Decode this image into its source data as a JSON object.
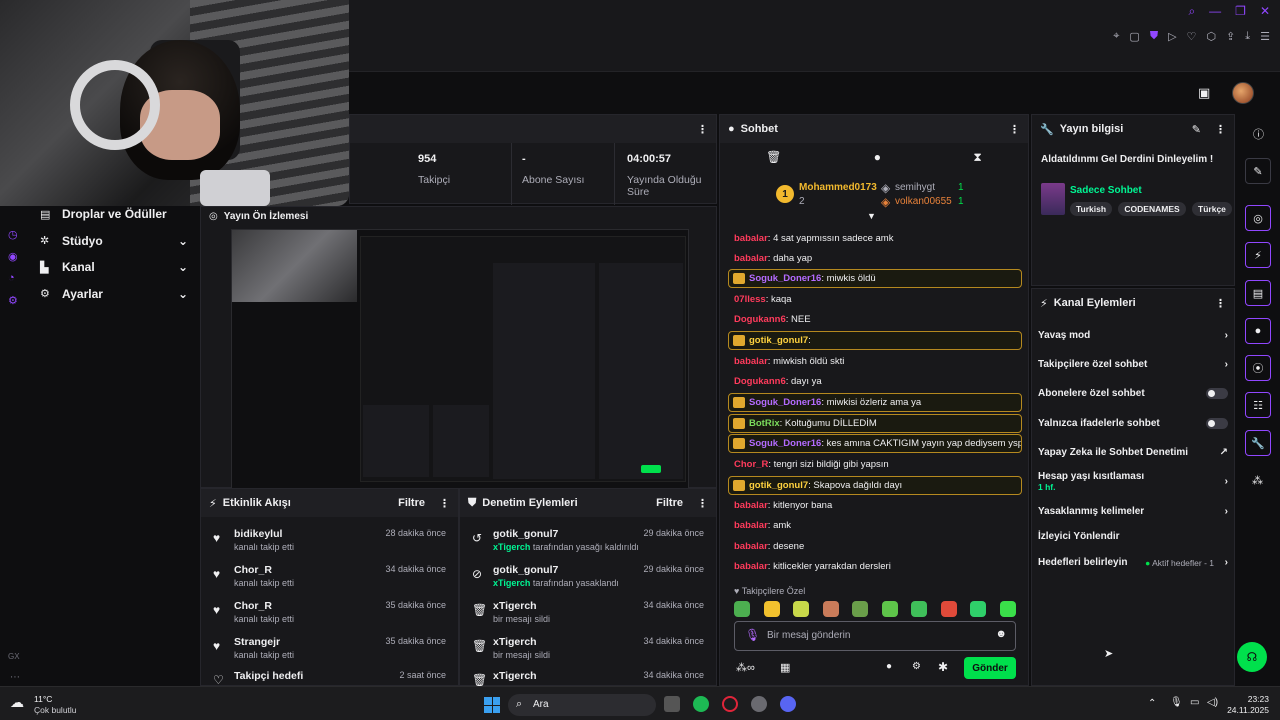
{
  "stats": [
    {
      "value": "954",
      "label": "Takipçi"
    },
    {
      "value": "-",
      "label": "Abone Sayısı"
    },
    {
      "value": "04:00:57",
      "label": "Yayında Olduğu Süre"
    }
  ],
  "nav": {
    "items": [
      {
        "label": "Droplar ve Ödüller"
      },
      {
        "label": "Stüdyo"
      },
      {
        "label": "Kanal"
      },
      {
        "label": "Ayarlar"
      }
    ],
    "rail_text": "GX"
  },
  "preview": {
    "title": "Yayın Ön İzlemesi"
  },
  "activity": {
    "title": "Etkinlik Akışı",
    "filter": "Filtre",
    "rows": [
      {
        "name": "bidikeylul",
        "sub": "kanalı takip etti",
        "time": "28 dakika önce"
      },
      {
        "name": "Chor_R",
        "sub": "kanalı takip etti",
        "time": "34 dakika önce"
      },
      {
        "name": "Chor_R",
        "sub": "kanalı takip etti",
        "time": "35 dakika önce"
      },
      {
        "name": "Strangejr",
        "sub": "kanalı takip etti",
        "time": "35 dakika önce"
      },
      {
        "name": "Takipçi hedefi",
        "sub": "",
        "time": "2 saat önce"
      }
    ]
  },
  "moderation": {
    "title": "Denetim Eylemleri",
    "filter": "Filtre",
    "rows": [
      {
        "name": "gotik_gonul7",
        "actor": "xTigerch",
        "sub": "tarafından yasağı kaldırıldı",
        "time": "29 dakika önce"
      },
      {
        "name": "gotik_gonul7",
        "actor": "xTigerch",
        "sub": "tarafından yasaklandı",
        "time": "29 dakika önce"
      },
      {
        "name": "xTigerch",
        "actor": "",
        "sub": "bir mesajı sildi",
        "time": "34 dakika önce"
      },
      {
        "name": "xTigerch",
        "actor": "",
        "sub": "bir mesajı sildi",
        "time": "34 dakika önce"
      },
      {
        "name": "xTigerch",
        "actor": "",
        "sub": "",
        "time": "34 dakika önce"
      }
    ]
  },
  "chat": {
    "title": "Sohbet",
    "leaderboard": {
      "first": {
        "name": "Mohammed0173",
        "score": "2"
      },
      "others": [
        {
          "name": "semihygt",
          "score": "1"
        },
        {
          "name": "volkan00655",
          "score": "1"
        }
      ]
    },
    "messages": [
      {
        "user": "babalar",
        "text": ": 4 sat yapmıssın sadece amk",
        "color": "#ff3b5c",
        "hl": false
      },
      {
        "user": "babalar",
        "text": ": daha yap",
        "color": "#ff3b5c",
        "hl": false
      },
      {
        "user": "Soguk_Doner16",
        "text": ": miwkis öldü",
        "color": "#b46bff",
        "hl": true
      },
      {
        "user": "07lless",
        "text": ": kaqa",
        "color": "#ff3b5c",
        "hl": false
      },
      {
        "user": "Dogukann6",
        "text": ": NEE",
        "color": "#ff3b5c",
        "hl": false
      },
      {
        "user": "gotik_gonul7",
        "text": ":",
        "color": "#ffd23f",
        "hl": true
      },
      {
        "user": "babalar",
        "text": ": miwkish öldü skti",
        "color": "#ff3b5c",
        "hl": false
      },
      {
        "user": "Dogukann6",
        "text": ": dayı ya",
        "color": "#ff3b5c",
        "hl": false
      },
      {
        "user": "Soguk_Doner16",
        "text": ": miwkisi özleriz ama ya",
        "color": "#b46bff",
        "hl": true
      },
      {
        "user": "BotRix",
        "text": ": Koltuğumu DİLLEDİM",
        "color": "#7bdc5c",
        "hl": true
      },
      {
        "user": "Soguk_Doner16",
        "text": ": kes amına CAKTIGIM yayın yap dediysem ysp",
        "color": "#b46bff",
        "hl": true
      },
      {
        "user": "Chor_R",
        "text": ": tengri sizi bildiği gibi yapsın",
        "color": "#ff3b5c",
        "hl": false
      },
      {
        "user": "gotik_gonul7",
        "text": ": Skapova dağıldı dayı",
        "color": "#ffd23f",
        "hl": true
      },
      {
        "user": "babalar",
        "text": ": kitlenyor bana",
        "color": "#ff3b5c",
        "hl": false
      },
      {
        "user": "babalar",
        "text": ": amk",
        "color": "#ff3b5c",
        "hl": false
      },
      {
        "user": "babalar",
        "text": ": desene",
        "color": "#ff3b5c",
        "hl": false
      },
      {
        "user": "babalar",
        "text": ": kitlicekler yarrakdan dersleri",
        "color": "#ff3b5c",
        "hl": false
      }
    ],
    "emote_header": "Takipçilere Özel",
    "input_placeholder": "Bir mesaj gönderin",
    "send_label": "Gönder"
  },
  "stream_info": {
    "title": "Yayın bilgisi",
    "stream_title": "Aldatıldınmı Gel Derdini Dinleyelim !",
    "category": "Sadece Sohbet",
    "tags": [
      "Turkish",
      "CODENAMES",
      "Türkçe"
    ]
  },
  "channel_actions": {
    "title": "Kanal Eylemleri",
    "items": [
      {
        "label": "Yavaş mod",
        "control": "chevron"
      },
      {
        "label": "Takipçilere özel sohbet",
        "control": "chevron"
      },
      {
        "label": "Abonelere özel sohbet",
        "control": "toggle"
      },
      {
        "label": "Yalnızca ifadelerle sohbet",
        "control": "toggle"
      },
      {
        "label": "Yapay Zeka ile Sohbet Denetimi",
        "control": "external"
      },
      {
        "label": "Hesap yaşı kısıtlaması",
        "sub": "1 hf.",
        "control": "chevron"
      },
      {
        "label": "Yasaklanmış kelimeler",
        "control": "chevron"
      },
      {
        "label": "İzleyici Yönlendir",
        "control": "none"
      },
      {
        "label": "Hedefleri belirleyin",
        "status": "Aktif hedefler - 1",
        "control": "chevron"
      }
    ]
  },
  "taskbar": {
    "weather_temp": "11°C",
    "weather_desc": "Çok bulutlu",
    "search_label": "Ara",
    "time": "23:23",
    "date": "24.11.2025"
  },
  "colors": {
    "accent": "#9147ff",
    "green": "#00e04c",
    "highlight_border": "#b5891f"
  }
}
